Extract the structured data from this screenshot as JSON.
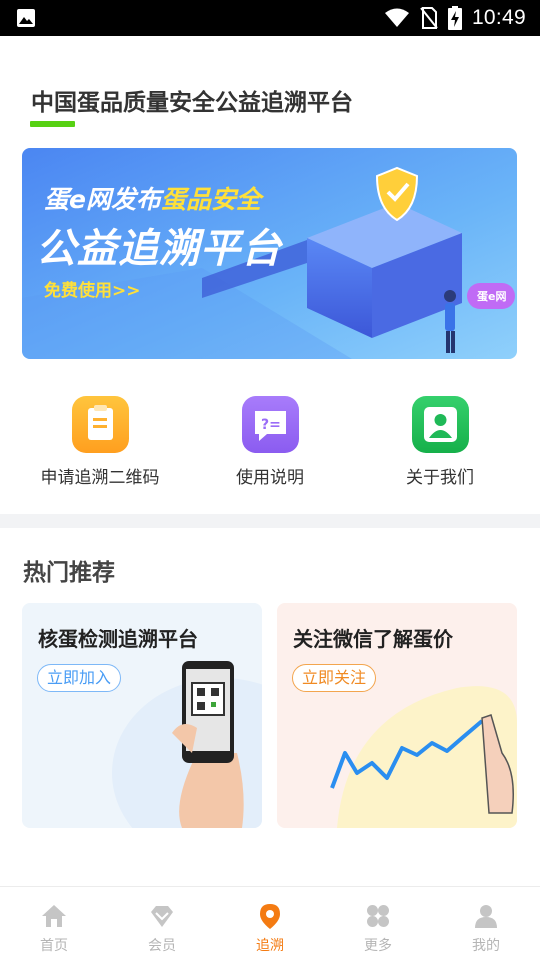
{
  "status_bar": {
    "time": "10:49"
  },
  "header": {
    "title": "中国蛋品质量安全公益追溯平台"
  },
  "banner": {
    "line1_prefix": "蛋e网发布",
    "line1_highlight": "蛋品安全",
    "line2": "公益追溯平台",
    "cta": "免费使用>>",
    "badge": "蛋e网"
  },
  "quick_entries": [
    {
      "label": "申请追溯二维码",
      "icon": "clipboard-icon",
      "color": "#ffab2e"
    },
    {
      "label": "使用说明",
      "icon": "question-message-icon",
      "color": "#9a6cf7"
    },
    {
      "label": "关于我们",
      "icon": "user-contact-icon",
      "color": "#25c05a"
    }
  ],
  "recommend": {
    "title": "热门推荐",
    "cards": [
      {
        "title": "核蛋检测追溯平台",
        "button": "立即加入"
      },
      {
        "title": "关注微信了解蛋价",
        "button": "立即关注"
      }
    ]
  },
  "bottom_nav": {
    "items": [
      {
        "label": "首页",
        "icon": "home-icon"
      },
      {
        "label": "会员",
        "icon": "diamond-icon"
      },
      {
        "label": "追溯",
        "icon": "location-pin-icon",
        "active": true
      },
      {
        "label": "更多",
        "icon": "grid-icon"
      },
      {
        "label": "我的",
        "icon": "person-icon"
      }
    ],
    "active_color": "#f47b12",
    "inactive_color": "#c5c5c5"
  }
}
